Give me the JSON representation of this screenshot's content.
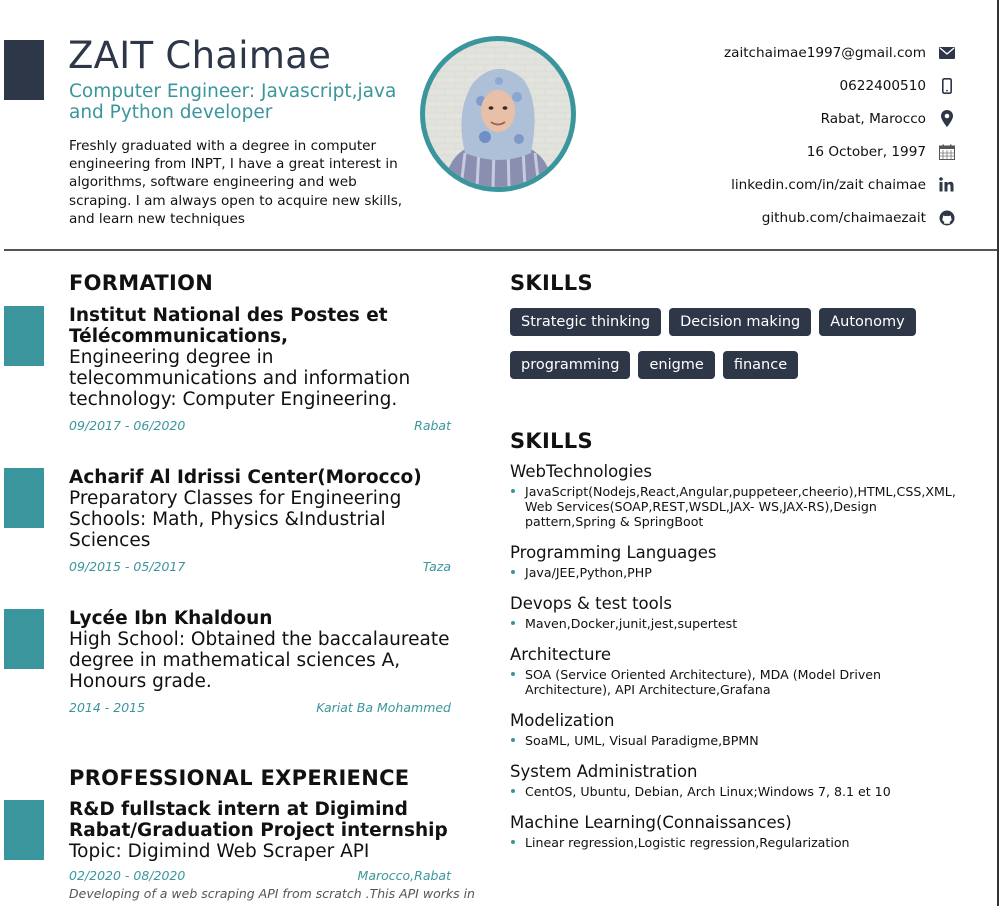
{
  "header": {
    "name": "ZAIT Chaimae",
    "role": "Computer Engineer: Javascript,java and Python developer",
    "summary": "Freshly graduated with a degree in computer engineering from INPT, I have a great interest in algorithms, software engineering and web scraping. I am always open to acquire new skills, and learn new techniques"
  },
  "contacts": [
    {
      "text": "zaitchaimae1997@gmail.com",
      "icon": "envelope-icon"
    },
    {
      "text": "0622400510",
      "icon": "mobile-phone-icon"
    },
    {
      "text": "Rabat, Marocco",
      "icon": "map-marker-icon"
    },
    {
      "text": "16 October, 1997",
      "icon": "calendar-icon"
    },
    {
      "text": "linkedin.com/in/zait chaimae",
      "icon": "linkedin-icon"
    },
    {
      "text": "github.com/chaimaezait",
      "icon": "github-icon"
    }
  ],
  "formation": {
    "title": "FORMATION",
    "items": [
      {
        "institution": "Institut National des Postes et Télécommunications,",
        "description": "Engineering degree in telecommunications and information technology: Computer Engineering.",
        "dates": "09/2017 - 06/2020",
        "location": "Rabat"
      },
      {
        "institution": "Acharif Al Idrissi Center(Morocco)",
        "description": "Preparatory Classes for Engineering Schools: Math, Physics &Industrial Sciences",
        "dates": "09/2015 - 05/2017",
        "location": "Taza"
      },
      {
        "institution": "Lycée Ibn Khaldoun",
        "description": "High School: Obtained the baccalaureate degree in mathematical sciences A, Honours grade.",
        "dates": "2014 - 2015",
        "location": "Kariat Ba Mohammed"
      }
    ]
  },
  "experience": {
    "title": "PROFESSIONAL EXPERIENCE",
    "items": [
      {
        "position": "R&D fullstack intern at Digimind Rabat/Graduation Project internship",
        "description": "Topic: Digimind Web Scraper API",
        "dates": "02/2020 - 08/2020",
        "location": "Marocco,Rabat",
        "details": "Developing of a web scraping API from scratch .This API works in"
      }
    ]
  },
  "soft_skills": {
    "title": "SKILLS",
    "tags": [
      "Strategic thinking",
      "Decision making",
      "Autonomy",
      "programming",
      "enigme",
      "finance"
    ]
  },
  "tech_skills": {
    "title": "SKILLS",
    "groups": [
      {
        "name": "WebTechnologies",
        "items": [
          "JavaScript(Nodejs,React,Angular,puppeteer,cheerio),HTML,CSS,XML, Web Services(SOAP,REST,WSDL,JAX- WS,JAX-RS),Design pattern,Spring & SpringBoot"
        ]
      },
      {
        "name": "Programming Languages",
        "items": [
          "Java/JEE,Python,PHP"
        ]
      },
      {
        "name": "Devops & test tools",
        "items": [
          "Maven,Docker,junit,jest,supertest"
        ]
      },
      {
        "name": "Architecture",
        "items": [
          "SOA (Service Oriented Architecture), MDA (Model Driven Architecture), API Architecture,Grafana"
        ]
      },
      {
        "name": "Modelization",
        "items": [
          "SoaML, UML, Visual Paradigme,BPMN"
        ]
      },
      {
        "name": "System Administration",
        "items": [
          "CentOS, Ubuntu, Debian, Arch Linux;Windows 7, 8.1 et 10"
        ]
      },
      {
        "name": "Machine Learning(Connaissances)",
        "items": [
          "Linear regression,Logistic regression,Regularization"
        ]
      }
    ]
  },
  "colors": {
    "accent": "#3a969c",
    "dark": "#2d3748"
  }
}
